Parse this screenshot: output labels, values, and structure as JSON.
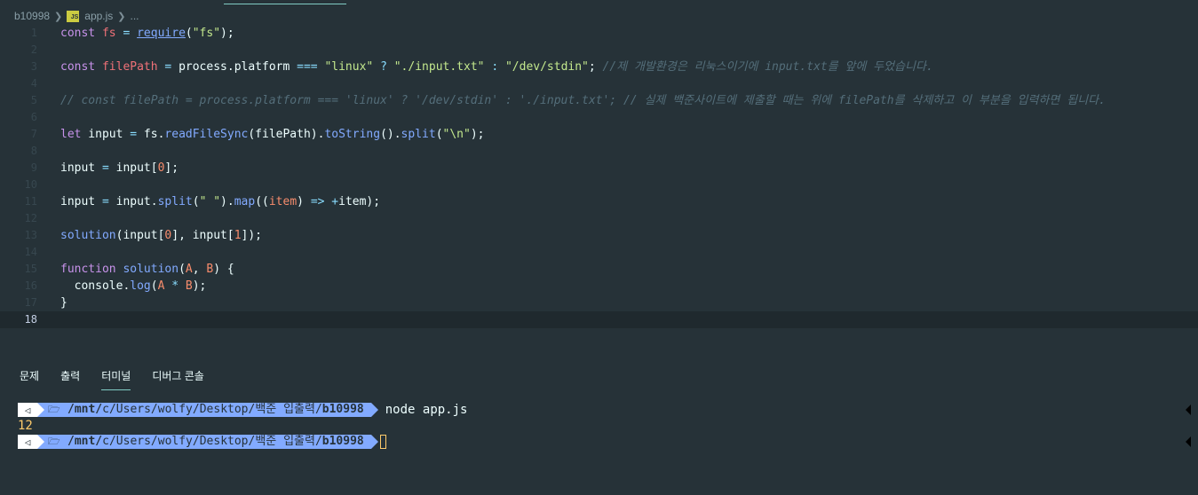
{
  "breadcrumb": {
    "folder": "b10998",
    "file_icon": "js-file-icon",
    "file_badge": "JS",
    "file": "app.js",
    "more": "..."
  },
  "editor": {
    "lines": [
      {
        "n": "1"
      },
      {
        "n": "2"
      },
      {
        "n": "3"
      },
      {
        "n": "4"
      },
      {
        "n": "5"
      },
      {
        "n": "6"
      },
      {
        "n": "7"
      },
      {
        "n": "8"
      },
      {
        "n": "9"
      },
      {
        "n": "10"
      },
      {
        "n": "11"
      },
      {
        "n": "12"
      },
      {
        "n": "13"
      },
      {
        "n": "14"
      },
      {
        "n": "15"
      },
      {
        "n": "16"
      },
      {
        "n": "17"
      },
      {
        "n": "18"
      }
    ],
    "comment_line3": "//제 개발환경은 리눅스이기에 input.txt를 앞에 두었습니다.",
    "comment_line5": "// const filePath = process.platform === 'linux' ? '/dev/stdin' : './input.txt'; // 실제 백준사이트에 제출할 때는 위에 filePath를 삭제하고 이 부분을 입력하면 됩니다."
  },
  "panel": {
    "tabs": [
      "문제",
      "출력",
      "터미널",
      "디버그 콘솔"
    ],
    "active_tab": "터미널"
  },
  "terminal": {
    "prompt_path_prefix": "/mnt/",
    "prompt_path_mid": "c/Users/wolfy/Desktop/백준 입출력/",
    "prompt_path_bold": "b10998",
    "command": "node app.js",
    "output": "12"
  },
  "colors": {
    "background": "#263238",
    "keyword": "#c792ea",
    "function": "#82aaff",
    "string": "#c3e88d",
    "number": "#f78c6c",
    "comment": "#546e7a",
    "prompt_bg": "#82aaff",
    "output": "#ffcb6b"
  }
}
